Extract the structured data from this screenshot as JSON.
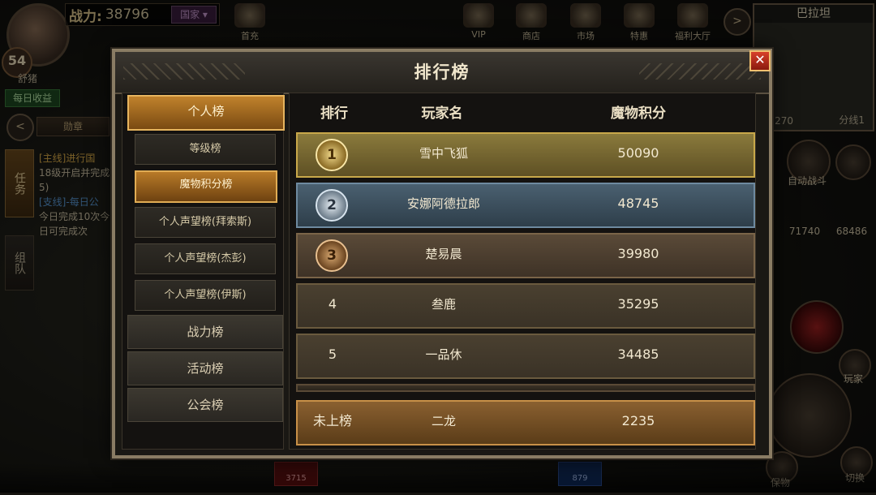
{
  "hud": {
    "power_label": "战力:",
    "power_value": "38796",
    "country": "国家",
    "level": "54",
    "player_name": "舒猪",
    "daily_income": "每日收益",
    "nav_prev": "<",
    "nav_next": ">",
    "medal": "勋章",
    "tabs": [
      "任务",
      "组队"
    ],
    "quests": [
      {
        "tag": "[主线]进行国",
        "text": "18级开启并完成5)"
      },
      {
        "tag": "[支线]-每日公",
        "text": "今日完成10次今日可完成次"
      }
    ],
    "top_icons": [
      {
        "label": "首充",
        "icon": "gift-icon"
      },
      {
        "label": "VIP",
        "icon": "vip-icon"
      },
      {
        "label": "商店",
        "icon": "shop-icon"
      },
      {
        "label": "市场",
        "icon": "market-scale-icon"
      },
      {
        "label": "特惠",
        "icon": "special-offer-icon"
      },
      {
        "label": "福利大厅",
        "icon": "welfare-icon"
      }
    ],
    "minimap": {
      "title": "巴拉坦",
      "coords": "62,270",
      "line": "分线1"
    },
    "auto_battle": "自动战斗",
    "stat_left": "71740",
    "stat_right": "68486",
    "player_btn": "玩家",
    "treasure_btn": "保物",
    "switch_btn": "切换",
    "hp": "3715",
    "mp": "879"
  },
  "modal": {
    "title": "排行榜",
    "close": "✕",
    "categories": [
      {
        "label": "个人榜",
        "active": true
      },
      {
        "label": "战力榜",
        "active": false
      },
      {
        "label": "活动榜",
        "active": false
      },
      {
        "label": "公会榜",
        "active": false
      }
    ],
    "sub_categories": [
      {
        "label": "等级榜",
        "active": false
      },
      {
        "label": "魔物积分榜",
        "active": true
      },
      {
        "label": "个人声望榜(拜索斯)",
        "active": false
      },
      {
        "label": "个人声望榜(杰彭)",
        "active": false
      },
      {
        "label": "个人声望榜(伊斯)",
        "active": false
      }
    ],
    "columns": {
      "rank": "排行",
      "name": "玩家名",
      "score": "魔物积分"
    },
    "rows": [
      {
        "rank": "1",
        "name": "雪中飞狐",
        "score": "50090"
      },
      {
        "rank": "2",
        "name": "安娜阿德拉郎",
        "score": "48745"
      },
      {
        "rank": "3",
        "name": "楚易晨",
        "score": "39980"
      },
      {
        "rank": "4",
        "name": "叁鹿",
        "score": "35295"
      },
      {
        "rank": "5",
        "name": "一品休",
        "score": "34485"
      }
    ],
    "my_row": {
      "rank": "未上榜",
      "name": "二龙",
      "score": "2235"
    }
  }
}
